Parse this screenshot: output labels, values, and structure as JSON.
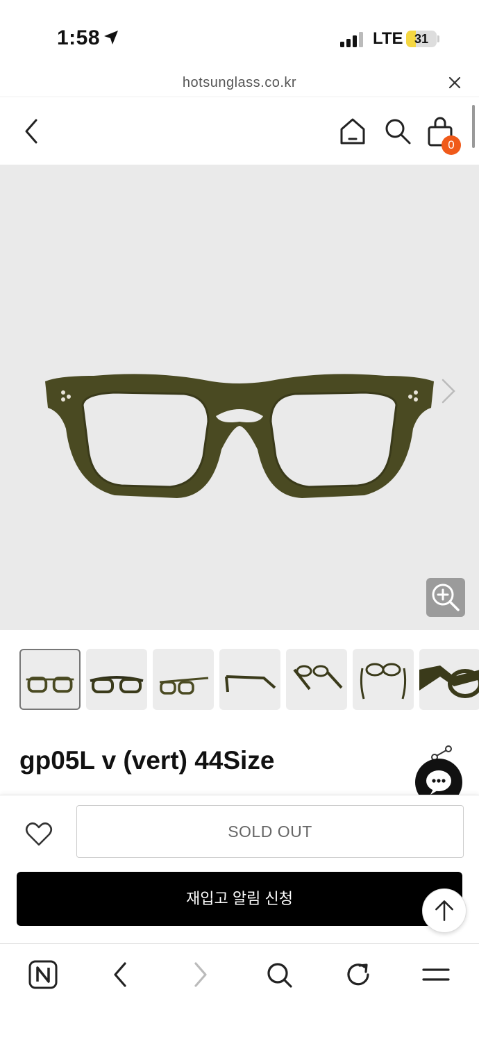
{
  "status_bar": {
    "time": "1:58",
    "network": "LTE",
    "battery": "31",
    "battery_level_percent": 31
  },
  "url_bar": {
    "url": "hotsunglass.co.kr"
  },
  "header": {
    "cart_count": "0"
  },
  "hero": {
    "image": "olive-green-eyeglasses",
    "background": "#eaeaea"
  },
  "thumbnails": [
    {
      "view": "front"
    },
    {
      "view": "front-folded"
    },
    {
      "view": "angle"
    },
    {
      "view": "side"
    },
    {
      "view": "top-angle"
    },
    {
      "view": "open-top"
    },
    {
      "view": "closeup"
    }
  ],
  "product": {
    "title": "gp05L v (vert) 44Size"
  },
  "actions": {
    "sold_out_label": "SOLD OUT",
    "restock_label": "재입고 알림 신청"
  },
  "colors": {
    "frame": "#4a4a22",
    "badge": "#f05a1a",
    "primary_button": "#000000"
  },
  "browser_toolbar": {
    "icons": [
      "naver-n-icon",
      "back-icon",
      "forward-icon",
      "search-icon",
      "refresh-icon",
      "menu-icon"
    ]
  }
}
